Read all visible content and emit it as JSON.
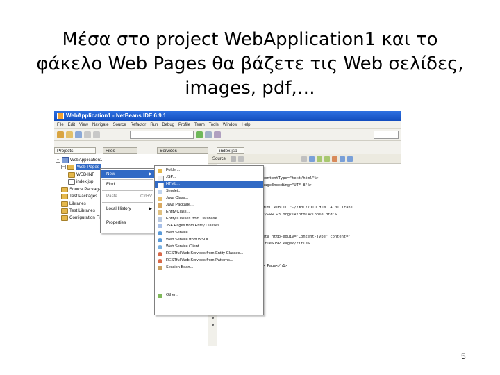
{
  "slide": {
    "title_line1": "Μέσα στο project WebApplication1 και το",
    "title_line2": "φάκελο Web Pages θα βάζετε τις Web σελίδες,",
    "title_line3": "images, pdf,…",
    "page_number": "5"
  },
  "ide": {
    "window_title": "WebApplication1 - NetBeans IDE 6.9.1",
    "menus": [
      "File",
      "Edit",
      "View",
      "Navigate",
      "Source",
      "Refactor",
      "Run",
      "Debug",
      "Profile",
      "Team",
      "Tools",
      "Window",
      "Help"
    ],
    "panel_tabs": {
      "projects": "Projects",
      "files": "Files",
      "services": "Services",
      "editor_file": "index.jsp"
    },
    "editor_toolbar": {
      "source_tab": "Source"
    },
    "tree": {
      "project": "WebApplication1",
      "selected_folder": "Web Pages",
      "children": [
        "WEB-INF",
        "index.jsp",
        "Source Packages",
        "Test Packages",
        "Libraries",
        "Test Libraries",
        "Configuration Files"
      ]
    },
    "context_menu": {
      "items": [
        "New",
        "Find...",
        "Paste",
        "Local History",
        "Properties"
      ],
      "paste_shortcut": "Ctrl+V"
    },
    "new_submenu": {
      "items": [
        "Folder...",
        "JSP...",
        "HTML...",
        "Servlet...",
        "Java Class...",
        "Java Package...",
        "Entity Class...",
        "Entity Classes from Database...",
        "JSF Pages from Entity Classes...",
        "Web Service...",
        "Web Service from WSDL...",
        "Web Service Client...",
        "RESTful Web Services from Entity Classes...",
        "RESTful Web Services from Patterns...",
        "Session Bean...",
        "Other..."
      ]
    },
    "code_lines": [
      "contentType=\"text/html\"%>",
      "pageEncoding=\"UTF-8\"%>",
      "",
      "HTML PUBLIC \"-//W3C//DTD HTML 4.01 Trans",
      "//www.w3.org/TR/html4/loose.dtd\">",
      "",
      "eta http-equiv=\"Content-Type\" content=\"",
      "itle>JSP Page</title>",
      "",
      "> Page</h1>"
    ],
    "colors": {
      "title_bar": "#124dbe",
      "selection": "#316ac5",
      "folder": "#e5b84c"
    }
  }
}
